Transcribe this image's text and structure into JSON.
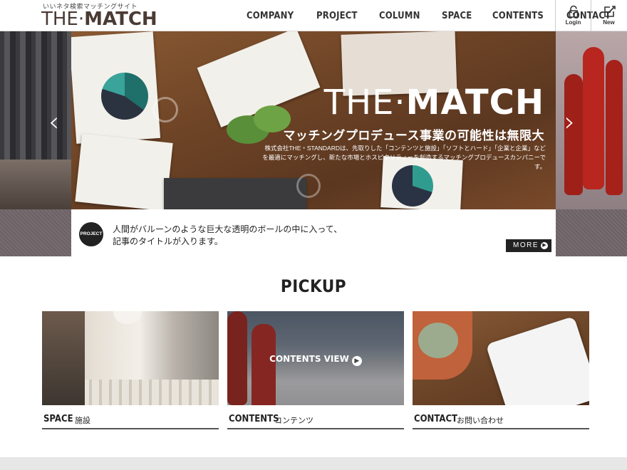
{
  "header": {
    "tagline": "いいネタ検索マッチングサイト",
    "logo_thin": "THE·",
    "logo_bold": "MATCH",
    "nav": [
      "COMPANY",
      "PROJECT",
      "COLUMN",
      "SPACE",
      "CONTENTS",
      "CONTACT"
    ],
    "login_label": "Login",
    "new_label": "New"
  },
  "hero": {
    "title_thin": "THE·",
    "title_bold": "MATCH",
    "subtitle": "マッチングプロデュース事業の可能性は無限大",
    "description": "株式会社THE・STANDARDは、先取りした「コンテンツと施設」「ソフトとハード」「企業と企業」などを最適にマッチングし、新たな市場とホスピタリティーを創造するマッチングプロデュースカンパニーです。",
    "prev_arrow": "‹",
    "next_arrow": "›"
  },
  "caption": {
    "badge": "PROJECT",
    "line1": "人間がバルーンのような巨大な透明のボールの中に入って、",
    "line2": "記事のタイトルが入ります。",
    "more_label": "MORE"
  },
  "pickup": {
    "title": "PICKUP",
    "cards": [
      {
        "en": "SPACE",
        "jp": "施設"
      },
      {
        "en": "CONTENTS",
        "jp": "コンテンツ",
        "overlay": "CONTENTS VIEW"
      },
      {
        "en": "CONTACT",
        "jp": "お問い合わせ"
      }
    ]
  },
  "colors": {
    "brand_text": "#4a3b34",
    "dark": "#222222",
    "pin_red": "#b8261f"
  }
}
